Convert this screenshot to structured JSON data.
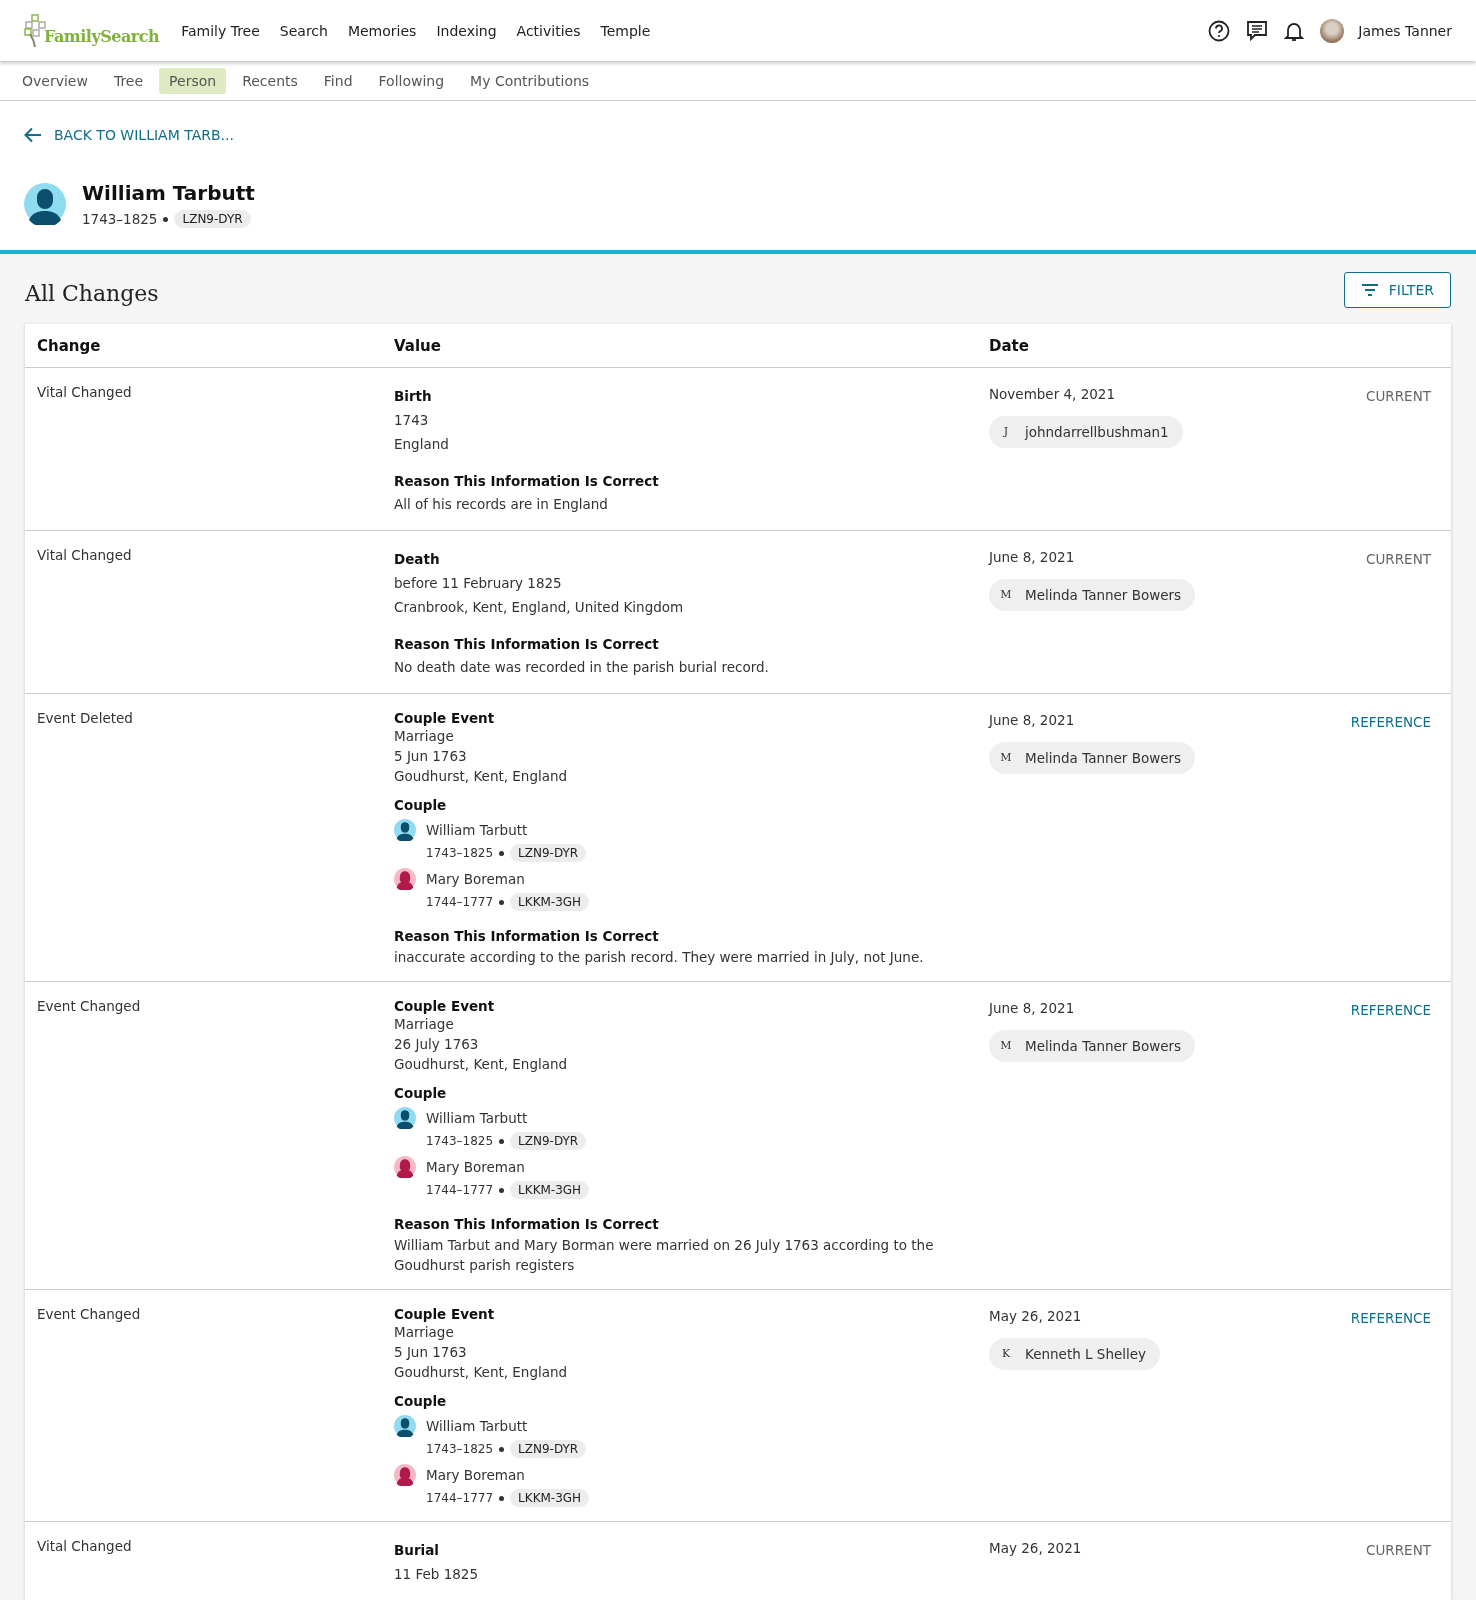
{
  "header": {
    "logo_text": "FamilySearch",
    "nav": [
      "Family Tree",
      "Search",
      "Memories",
      "Indexing",
      "Activities",
      "Temple"
    ],
    "user": "James Tanner"
  },
  "subnav": [
    {
      "label": "Overview",
      "selected": false
    },
    {
      "label": "Tree",
      "selected": false
    },
    {
      "label": "Person",
      "selected": true
    },
    {
      "label": "Recents",
      "selected": false
    },
    {
      "label": "Find",
      "selected": false
    },
    {
      "label": "Following",
      "selected": false
    },
    {
      "label": "My Contributions",
      "selected": false
    }
  ],
  "back_link": "BACK TO WILLIAM TARB...",
  "person": {
    "name": "William Tarbutt",
    "years": "1743–1825",
    "pid": "LZN9-DYR",
    "kind": "male"
  },
  "section": {
    "title": "All Changes",
    "filter": "FILTER"
  },
  "table": {
    "columns": [
      "Change",
      "Value",
      "Date"
    ],
    "rows": [
      {
        "change": "Vital Changed",
        "kind": "vital",
        "value_title": "Birth",
        "lines": [
          "1743",
          "England"
        ],
        "reason_label": "Reason This Information Is Correct",
        "reason": "All of his records are in England",
        "date": "November 4, 2021",
        "user_initial": "J",
        "user": "johndarrellbushman1",
        "status": {
          "label": "CURRENT",
          "kind": "current"
        }
      },
      {
        "change": "Vital Changed",
        "kind": "vital",
        "value_title": "Death",
        "lines": [
          "before 11 February 1825",
          "Cranbrook, Kent, England, United Kingdom"
        ],
        "reason_label": "Reason This Information Is Correct",
        "reason": "No death date was recorded in the parish burial record.",
        "date": "June 8, 2021",
        "user_initial": "M",
        "user": "Melinda Tanner Bowers",
        "status": {
          "label": "CURRENT",
          "kind": "current"
        }
      },
      {
        "change": "Event Deleted",
        "kind": "event",
        "value_title": "Couple Event",
        "lines": [
          "Marriage",
          "5 Jun 1763",
          "Goudhurst, Kent, England"
        ],
        "couple_label": "Couple",
        "couple": [
          {
            "name": "William Tarbutt",
            "years": "1743–1825",
            "pid": "LZN9-DYR",
            "kind": "male"
          },
          {
            "name": "Mary Boreman",
            "years": "1744–1777",
            "pid": "LKKM-3GH",
            "kind": "female"
          }
        ],
        "reason_label": "Reason This Information Is Correct",
        "reason": "inaccurate according to the parish record. They were married in July, not June.",
        "date": "June 8, 2021",
        "user_initial": "M",
        "user": "Melinda Tanner Bowers",
        "status": {
          "label": "REFERENCE",
          "kind": "reference"
        }
      },
      {
        "change": "Event Changed",
        "kind": "event",
        "value_title": "Couple Event",
        "lines": [
          "Marriage",
          "26 July 1763",
          "Goudhurst, Kent, England"
        ],
        "couple_label": "Couple",
        "couple": [
          {
            "name": "William Tarbutt",
            "years": "1743–1825",
            "pid": "LZN9-DYR",
            "kind": "male"
          },
          {
            "name": "Mary Boreman",
            "years": "1744–1777",
            "pid": "LKKM-3GH",
            "kind": "female"
          }
        ],
        "reason_label": "Reason This Information Is Correct",
        "reason": "William Tarbut and Mary Borman were married on 26 July 1763 according to the Goudhurst parish registers",
        "date": "June 8, 2021",
        "user_initial": "M",
        "user": "Melinda Tanner Bowers",
        "status": {
          "label": "REFERENCE",
          "kind": "reference"
        }
      },
      {
        "change": "Event Changed",
        "kind": "event",
        "value_title": "Couple Event",
        "lines": [
          "Marriage",
          "5 Jun 1763",
          "Goudhurst, Kent, England"
        ],
        "couple_label": "Couple",
        "couple": [
          {
            "name": "William Tarbutt",
            "years": "1743–1825",
            "pid": "LZN9-DYR",
            "kind": "male"
          },
          {
            "name": "Mary Boreman",
            "years": "1744–1777",
            "pid": "LKKM-3GH",
            "kind": "female"
          }
        ],
        "date": "May 26, 2021",
        "user_initial": "K",
        "user": "Kenneth L Shelley",
        "status": {
          "label": "REFERENCE",
          "kind": "reference"
        }
      },
      {
        "change": "Vital Changed",
        "kind": "vital",
        "value_title": "Burial",
        "lines": [
          "11 Feb 1825"
        ],
        "date": "May 26, 2021",
        "status": {
          "label": "CURRENT",
          "kind": "current"
        }
      }
    ]
  }
}
